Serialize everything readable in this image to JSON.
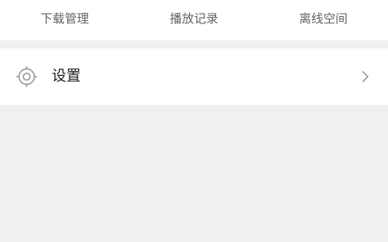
{
  "top_tabs": [
    {
      "label": "下载管理"
    },
    {
      "label": "播放记录"
    },
    {
      "label": "离线空间"
    }
  ],
  "settings": {
    "label": "设置",
    "icon": "settings-icon",
    "trailing_icon": "chevron-right-icon"
  },
  "colors": {
    "background": "#eff0f2",
    "surface": "#ffffff",
    "tab_text": "#5f6368",
    "primary_text": "#1f1f1f",
    "icon": "#9aa0a6"
  }
}
